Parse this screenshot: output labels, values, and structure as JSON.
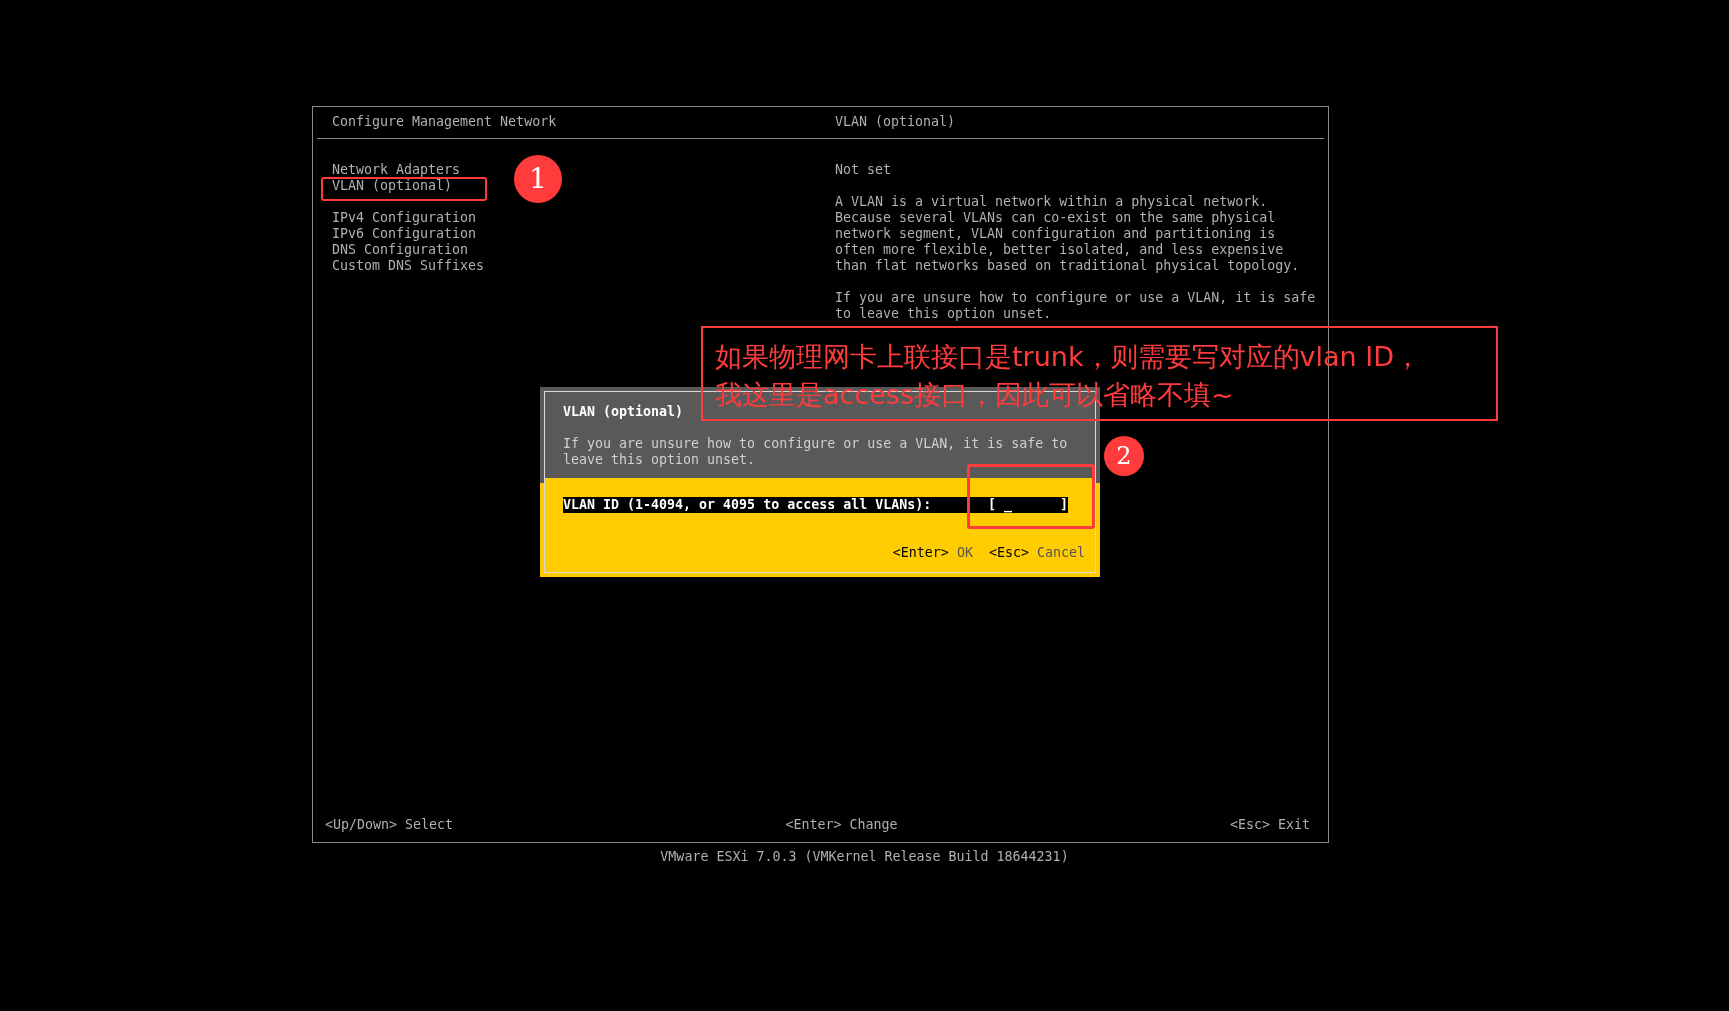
{
  "header": {
    "title": "Configure Management Network",
    "detail_title": "VLAN (optional)"
  },
  "menu": [
    [
      "Network Adapters",
      "VLAN (optional)"
    ],
    [
      "IPv4 Configuration",
      "IPv6 Configuration",
      "DNS Configuration",
      "Custom DNS Suffixes"
    ]
  ],
  "detail": {
    "value": "Not set",
    "paragraphs": [
      "A VLAN is a virtual network within a physical network. Because several VLANs can co-exist on the same physical network segment, VLAN configuration and partitioning is often more flexible, better isolated, and less expensive than flat networks based on traditional physical topology.",
      "If you are unsure how to configure or use a VLAN, it is safe to leave this option unset."
    ]
  },
  "footer": [
    {
      "key": "<Up/Down>",
      "action": "Select"
    },
    {
      "key": "<Enter>",
      "action": "Change"
    },
    {
      "key": "<Esc>",
      "action": "Exit"
    }
  ],
  "version": "VMware ESXi 7.0.3 (VMKernel Release Build 18644231)",
  "dialog": {
    "title": "VLAN (optional)",
    "text": "If you are unsure how to configure or use a VLAN, it is safe to leave this option unset.",
    "field": {
      "label": "VLAN ID (1-4094, or 4095 to access all VLANs):",
      "value": "[ _      ]"
    },
    "buttons": [
      {
        "key": "<Enter>",
        "label": "OK"
      },
      {
        "key": "<Esc>",
        "label": "Cancel"
      }
    ]
  },
  "annotations": {
    "badges": [
      "1",
      "2"
    ],
    "note_lines": [
      "如果物理网卡上联接口是trunk，则需要写对应的vlan ID，",
      "我这里是access接口，因此可以省略不填~"
    ]
  }
}
